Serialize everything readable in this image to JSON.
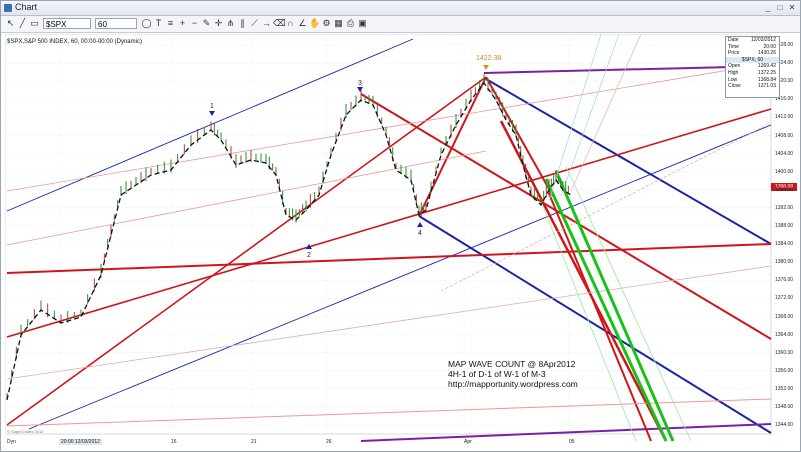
{
  "window": {
    "title": "Chart",
    "minimize": "_",
    "maximize": "□",
    "close": "✕"
  },
  "toolbar": {
    "symbol": "$SPX",
    "interval": "60",
    "tools": [
      "cursor-icon",
      "line-icon",
      "rect-icon",
      "ellipse-icon",
      "text-icon",
      "fib-icon",
      "zoom-in-icon",
      "zoom-out-icon",
      "pencil-icon",
      "crosshair-icon",
      "pitchfork-icon",
      "channel-icon",
      "trendline-icon",
      "arrow-icon",
      "eraser-icon",
      "magnet-icon",
      "gann-icon",
      "hand-icon",
      "settings-icon",
      "grid-icon",
      "print-icon",
      "save-icon"
    ]
  },
  "chart": {
    "heading": "$SPX,S&P 500 INDEX, 60, 00:00-00:00 (Dynamic)",
    "peak_label": "1422.38",
    "wave_labels": [
      "1",
      "2",
      "3",
      "4"
    ],
    "annotation": [
      "MAP WAVE COUNT @ 8Apr2012",
      "4H-1 of D-1 of  W-1 of M-3",
      "http://mapportunity.wordpress.com"
    ],
    "last_price": "1398.08",
    "y_ticks": [
      "1428.00",
      "1424.00",
      "1420.00",
      "1416.00",
      "1412.00",
      "1408.00",
      "1404.00",
      "1400.00",
      "1396.00",
      "1392.00",
      "1388.00",
      "1384.00",
      "1380.00",
      "1376.00",
      "1372.00",
      "1368.00",
      "1364.00",
      "1360.00",
      "1356.00",
      "1352.00",
      "1348.00",
      "1344.00"
    ],
    "x_ticks": [
      "Dyn",
      "20:00 12/03/2012",
      "16",
      "21",
      "26",
      "Apr",
      "05"
    ],
    "watermark": "© SuperCharts 2012"
  },
  "data_window": {
    "rows": [
      {
        "label": "Date",
        "value": "12/03/2012"
      },
      {
        "label": "Time",
        "value": "20:00"
      },
      {
        "label": "Price",
        "value": "1430.26"
      }
    ],
    "section": "$SPX, 60",
    "ohlc": [
      {
        "label": "Open",
        "value": "1369.42"
      },
      {
        "label": "High",
        "value": "1372.25"
      },
      {
        "label": "Low",
        "value": "1368.84"
      },
      {
        "label": "Close",
        "value": "1371.03"
      }
    ]
  },
  "colors": {
    "blue": "#1b22a8",
    "red": "#d0151a",
    "green": "#18c318",
    "purple": "#7a1fa6",
    "price_bg": "#c8151a"
  }
}
